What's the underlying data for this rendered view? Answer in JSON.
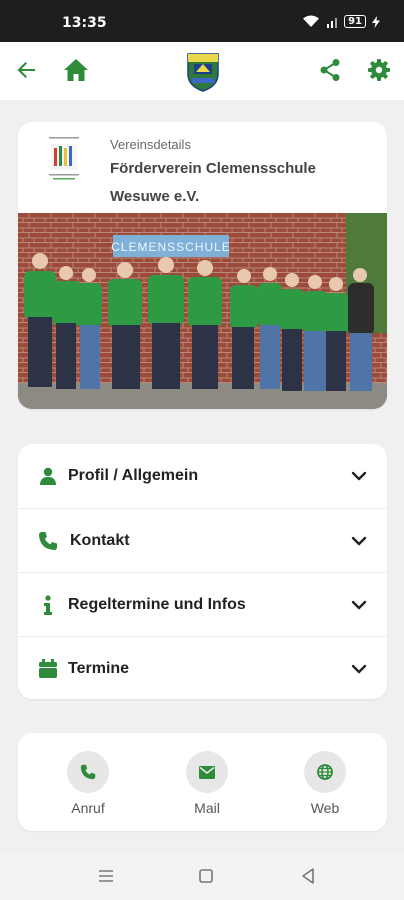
{
  "status_bar": {
    "time": "13:35",
    "battery": "91"
  },
  "colors": {
    "accent": "#2e8b3a",
    "card": "#ffffff",
    "background": "#f0f0f0"
  },
  "app_bar": {
    "icons": [
      "back-arrow-icon",
      "home-icon",
      "share-icon",
      "settings-gear-icon"
    ]
  },
  "details": {
    "kicker": "Vereinsdetails",
    "name": "Förderverein Clemensschule Wesuwe e.V.",
    "photo_sign": "CLEMENSSCHULE"
  },
  "accordion": {
    "items": [
      {
        "label": "Profil / Allgemein",
        "icon": "person-icon"
      },
      {
        "label": "Kontakt",
        "icon": "phone-icon"
      },
      {
        "label": "Regeltermine und Infos",
        "icon": "info-icon"
      },
      {
        "label": "Termine",
        "icon": "calendar-icon"
      }
    ]
  },
  "contact": {
    "call": "Anruf",
    "mail": "Mail",
    "web": "Web"
  }
}
